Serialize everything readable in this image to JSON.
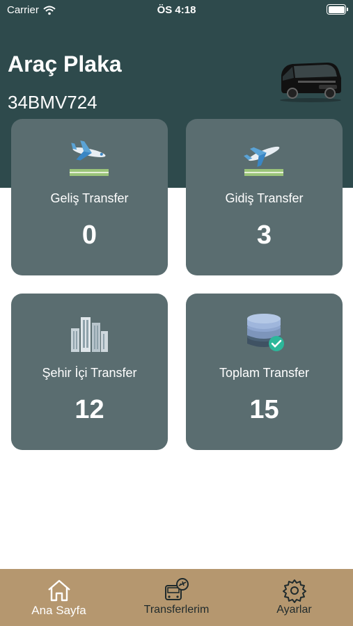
{
  "status_bar": {
    "carrier": "Carrier",
    "time": "ÖS 4:18"
  },
  "header": {
    "title": "Araç Plaka",
    "plate": "34BMV724"
  },
  "cards": [
    {
      "label": "Geliş Transfer",
      "value": "0",
      "icon": "airplane-arrival-icon"
    },
    {
      "label": "Gidiş Transfer",
      "value": "3",
      "icon": "airplane-departure-icon"
    },
    {
      "label": "Şehir İçi Transfer",
      "value": "12",
      "icon": "city-buildings-icon"
    },
    {
      "label": "Toplam Transfer",
      "value": "15",
      "icon": "database-check-icon"
    }
  ],
  "tabbar": {
    "items": [
      {
        "label": "Ana Sayfa",
        "icon": "home-icon",
        "active": true
      },
      {
        "label": "Transferlerim",
        "icon": "bus-plane-icon",
        "active": false
      },
      {
        "label": "Ayarlar",
        "icon": "gear-icon",
        "active": false
      }
    ]
  },
  "colors": {
    "header_bg": "#2e4a4c",
    "card_bg": "#5a6d70",
    "tabbar_bg": "#b5976f"
  }
}
